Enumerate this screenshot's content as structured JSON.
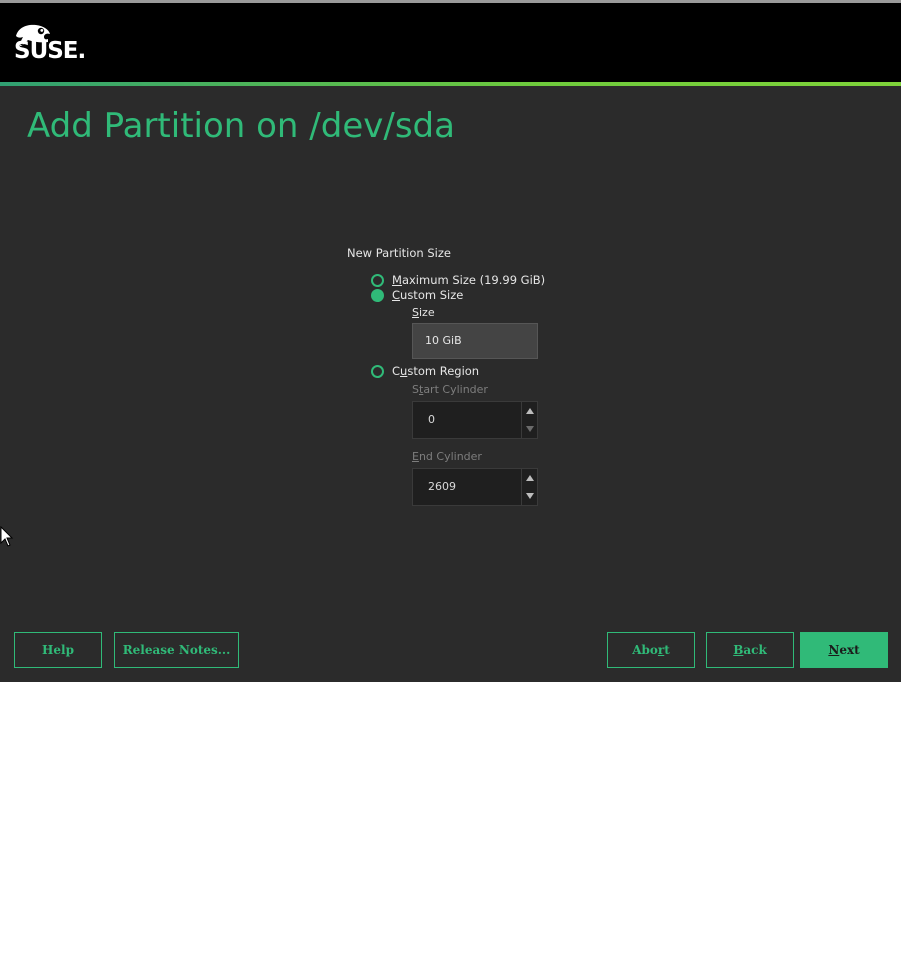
{
  "header": {
    "logo_text": "SUSE.",
    "accent_color": "#30ba78"
  },
  "page": {
    "title": "Add Partition on /dev/sda"
  },
  "form": {
    "group_label": "New Partition Size",
    "options": [
      {
        "label_prefix": "",
        "label_accel": "M",
        "label_rest": "aximum Size (19.99 GiB)",
        "selected": false
      },
      {
        "label_prefix": "",
        "label_accel": "C",
        "label_rest": "ustom Size",
        "selected": true
      },
      {
        "label_prefix": "C",
        "label_accel": "u",
        "label_rest": "stom Region",
        "selected": false
      }
    ],
    "size": {
      "label_accel": "S",
      "label_rest": "ize",
      "value": "10 GiB"
    },
    "start_cylinder": {
      "label_prefix": "S",
      "label_accel": "t",
      "label_rest": "art Cylinder",
      "value": "0"
    },
    "end_cylinder": {
      "label_accel": "E",
      "label_rest": "nd Cylinder",
      "value": "2609"
    }
  },
  "footer": {
    "help": "Help",
    "release_notes": "Release Notes...",
    "abort_prefix": "Abo",
    "abort_accel": "r",
    "abort_rest": "t",
    "back_accel": "B",
    "back_rest": "ack",
    "next_accel": "N",
    "next_rest": "ext"
  }
}
